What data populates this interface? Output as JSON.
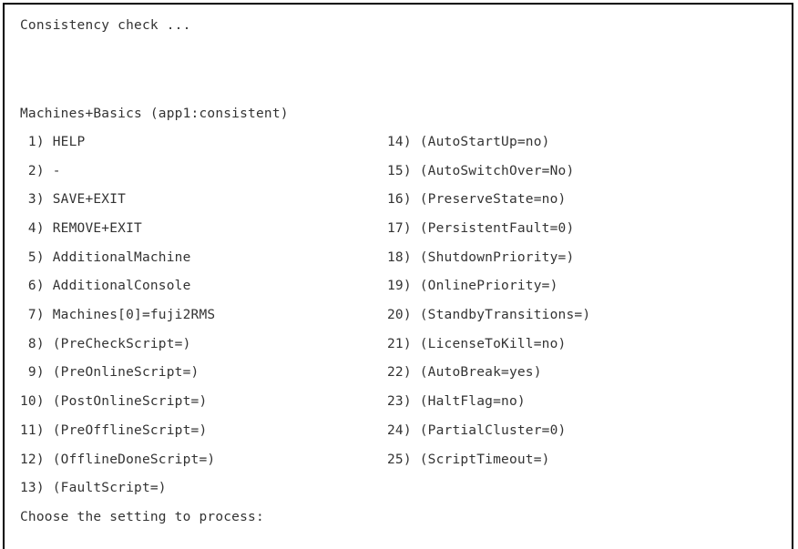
{
  "header": {
    "status_text": "Consistency check ..."
  },
  "menu": {
    "title": "Machines+Basics (app1:consistent)",
    "left_items": [
      " 1) HELP",
      " 2) -",
      " 3) SAVE+EXIT",
      " 4) REMOVE+EXIT",
      " 5) AdditionalMachine",
      " 6) AdditionalConsole",
      " 7) Machines[0]=fuji2RMS",
      " 8) (PreCheckScript=)",
      " 9) (PreOnlineScript=)",
      "10) (PostOnlineScript=)",
      "11) (PreOfflineScript=)",
      "12) (OfflineDoneScript=)",
      "13) (FaultScript=)"
    ],
    "right_items": [
      "14) (AutoStartUp=no)",
      "15) (AutoSwitchOver=No)",
      "16) (PreserveState=no)",
      "17) (PersistentFault=0)",
      "18) (ShutdownPriority=)",
      "19) (OnlinePriority=)",
      "20) (StandbyTransitions=)",
      "21) (LicenseToKill=no)",
      "22) (AutoBreak=yes)",
      "23) (HaltFlag=no)",
      "24) (PartialCluster=0)",
      "25) (ScriptTimeout=)"
    ],
    "prompt": "Choose the setting to process:"
  }
}
